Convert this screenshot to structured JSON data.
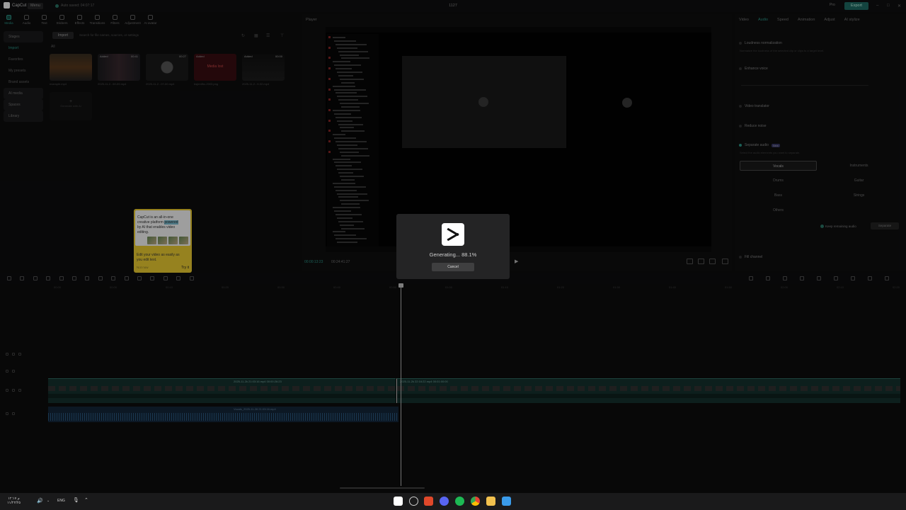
{
  "app": {
    "name": "CapCut",
    "menu": "Menu",
    "autosave": "Auto saved: 04:07:17",
    "window_title": "1127",
    "pro": "Pro",
    "export": "Export"
  },
  "toolbar": [
    {
      "label": "Media",
      "active": true
    },
    {
      "label": "Audio"
    },
    {
      "label": "Text"
    },
    {
      "label": "Stickers"
    },
    {
      "label": "Effects"
    },
    {
      "label": "Transitions"
    },
    {
      "label": "Filters"
    },
    {
      "label": "Adjustment"
    },
    {
      "label": "AI avatar"
    }
  ],
  "sidebar": [
    {
      "label": "Stages",
      "type": "hdr"
    },
    {
      "label": "Import",
      "type": "sel"
    },
    {
      "label": "Favorites"
    },
    {
      "label": "My presets"
    },
    {
      "label": "Brand assets"
    },
    {
      "label": "AI media",
      "type": "hdr"
    },
    {
      "label": "Spaces",
      "type": "hdr"
    },
    {
      "label": "Library",
      "type": "hdr"
    }
  ],
  "media": {
    "import": "Import",
    "search_placeholder": "Search for file names, sources, or settings",
    "all_label": "All",
    "items": [
      {
        "name": "example.mp4",
        "added": "",
        "duration": ""
      },
      {
        "name": "2025-11-2...50-09.mp4",
        "added": "Added",
        "duration": "00:41"
      },
      {
        "name": "2025-11-2...07-00.mp4",
        "added": "",
        "duration": "00:27"
      },
      {
        "name": "bsjmnfhc-2003.png",
        "added": "Added",
        "duration": ""
      },
      {
        "name": "2025-11-2...9-02.mp4",
        "added": "Added",
        "duration": "00:00"
      }
    ],
    "missing_label": "Media lost",
    "create_label": "Generate with AI"
  },
  "tooltip": {
    "line1": "CapCut is an all-in-one",
    "line2": "creative platform",
    "highlight": "powered",
    "line3": "by AI that enables video",
    "line4": "editing.",
    "foot1": "Edit your video as easily as",
    "foot2": "you edit text.",
    "not_now": "Not now",
    "try_it": "Try it"
  },
  "player": {
    "label": "Player",
    "time_current": "00:00:13:23",
    "time_total": "00:24:41:27"
  },
  "dialog": {
    "status": "Generating... 88.1%",
    "progress": 0.881,
    "cancel": "Cancel"
  },
  "right_panel": {
    "tabs": [
      {
        "label": "Video"
      },
      {
        "label": "Audio",
        "selected": true
      },
      {
        "label": "Speed"
      },
      {
        "label": "Animation"
      },
      {
        "label": "Adjust"
      },
      {
        "label": "AI stylize"
      }
    ],
    "loudness": "Loudness normalization",
    "loudness_desc": "Normalize the loudness of the selected clip or clips to a target level.",
    "enhance": "Enhance voice",
    "translator": "Video translator",
    "reduce": "Reduce noise",
    "separate": "Separate audio",
    "separate_badge": "New",
    "separate_desc": "Select the audio elements you want to separate.",
    "options": [
      {
        "label": "Vocals",
        "selected": true
      },
      {
        "label": "Instruments"
      },
      {
        "label": "Drums"
      },
      {
        "label": "Guitar"
      },
      {
        "label": "Bass"
      },
      {
        "label": "Strings"
      },
      {
        "label": "Others"
      }
    ],
    "keep": "Keep remaining audio",
    "separate_btn": "Separate",
    "fill": "Fill channel"
  },
  "timeline": {
    "ticks": [
      "00:00",
      "00:00",
      "00:10",
      "00:20",
      "00:30",
      "00:40",
      "00:50",
      "01:00",
      "01:10",
      "01:20",
      "01:30",
      "01:40",
      "01:50",
      "02:00",
      "02:10",
      "02:20"
    ],
    "clip1": "2025-11-2k 21:03:16.mp4   00:00:26:23",
    "clip2": "2025-11-2k 22:16:22.mp4   00:01:00:00",
    "audio": "Vocals_2025-11-26 21:03:16.mp4"
  },
  "taskbar": {
    "lang": "ENG",
    "time": "م ١٢:١٧",
    "date": "١١/٢٢/٢٥"
  }
}
